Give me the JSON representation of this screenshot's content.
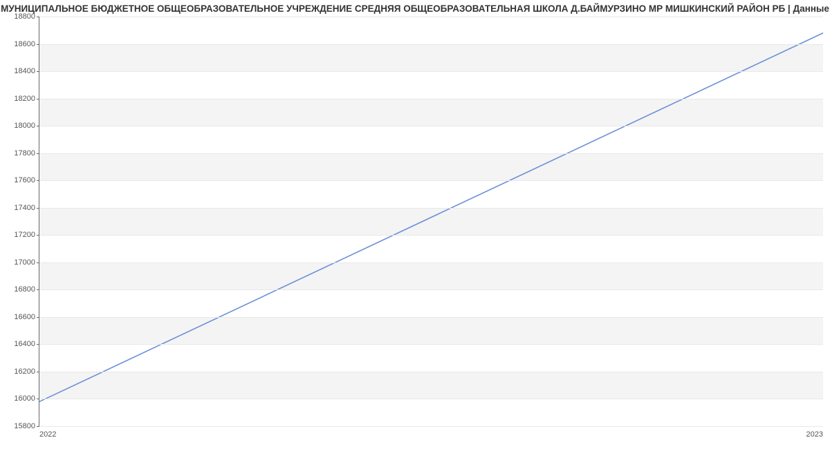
{
  "chart_data": {
    "type": "line",
    "title": "МУНИЦИПАЛЬНОЕ БЮДЖЕТНОЕ ОБЩЕОБРАЗОВАТЕЛЬНОЕ УЧРЕЖДЕНИЕ СРЕДНЯЯ ОБЩЕОБРАЗОВАТЕЛЬНАЯ ШКОЛА Д.БАЙМУРЗИНО МР МИШКИНСКИЙ РАЙОН РБ | Данные",
    "x": [
      2022,
      2023
    ],
    "series": [
      {
        "name": "s1",
        "values": [
          15980,
          18680
        ]
      }
    ],
    "xticks": [
      2022,
      2023
    ],
    "yticks": [
      15800,
      16000,
      16200,
      16400,
      16600,
      16800,
      17000,
      17200,
      17400,
      17600,
      17800,
      18000,
      18200,
      18400,
      18600,
      18800
    ],
    "ylim": [
      15800,
      18800
    ],
    "xlim": [
      2022,
      2023
    ],
    "xlabel": "",
    "ylabel": "",
    "line_color": "#6a8fd8"
  }
}
